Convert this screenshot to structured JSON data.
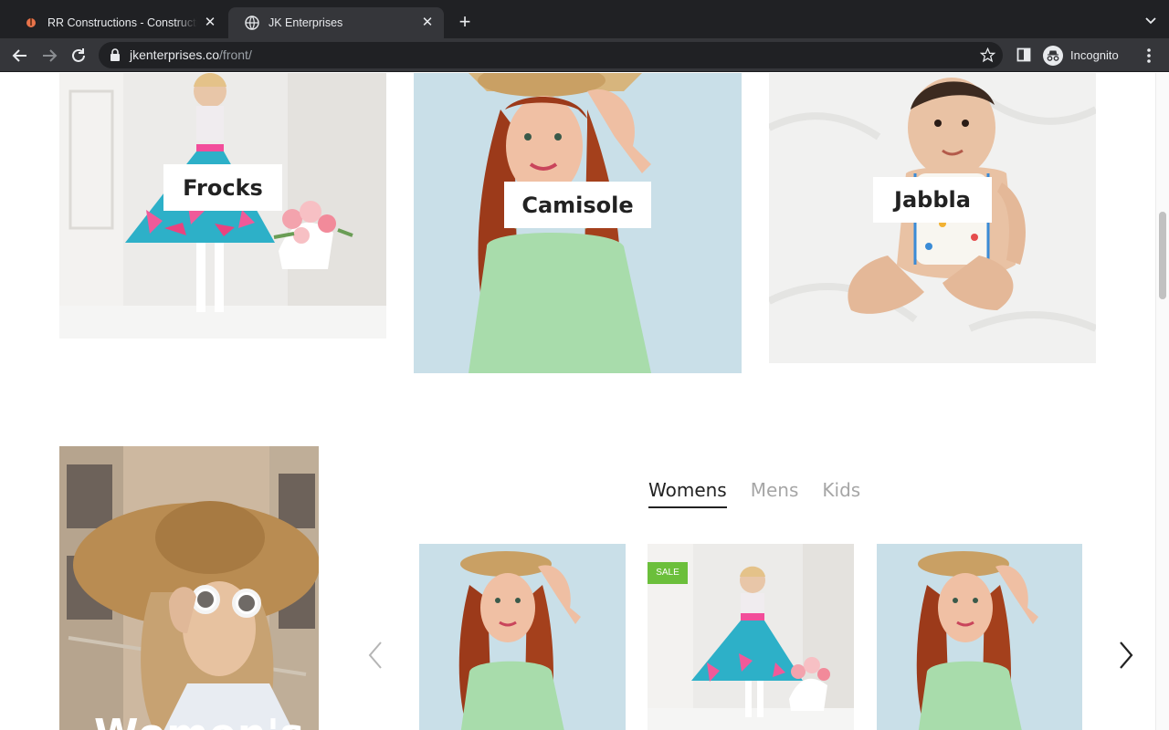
{
  "browser": {
    "tabs": [
      {
        "title": "RR Constructions - Construction",
        "active": false
      },
      {
        "title": "JK Enterprises",
        "active": true
      }
    ],
    "url_domain": "jkenterprises.co",
    "url_path": "/front/",
    "profile_label": "Incognito"
  },
  "categories": [
    {
      "label": "Frocks"
    },
    {
      "label": "Camisole"
    },
    {
      "label": "Jabbla"
    }
  ],
  "promo": {
    "text": "Women's"
  },
  "product_tabs": [
    {
      "label": "Womens",
      "active": true
    },
    {
      "label": "Mens",
      "active": false
    },
    {
      "label": "Kids",
      "active": false
    }
  ],
  "products": [
    {
      "badge": ""
    },
    {
      "badge": "SALE"
    },
    {
      "badge": ""
    }
  ],
  "colors": {
    "chrome_dark": "#202124",
    "chrome_toolbar": "#35363a",
    "sale_badge": "#6bbf3b",
    "text_dark": "#222222",
    "tab_muted": "#a6a6a6"
  }
}
